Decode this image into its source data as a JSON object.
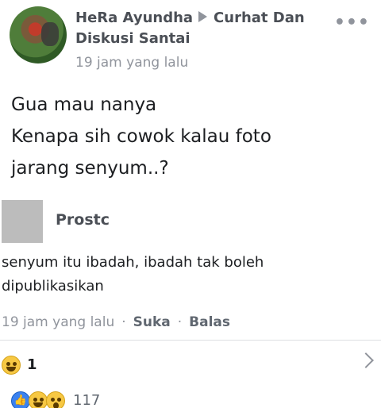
{
  "post": {
    "author": "HeRa Ayundha",
    "group_line1": "Curhat Dan",
    "group_line2": "Diskusi Santai",
    "time": "19 jam yang lalu",
    "more": "•••",
    "body_lines": [
      "Gua mau nanya",
      "Kenapa sih cowok kalau foto",
      "jarang senyum..?"
    ]
  },
  "comment": {
    "author": "Prostc",
    "text_line1": "senyum itu ibadah, ibadah tak boleh",
    "text_line2": "dipublikasikan",
    "time": "19 jam yang lalu",
    "separator": "·",
    "like_label": "Suka",
    "reply_label": "Balas",
    "reaction_icon": "haha-emoji-icon",
    "reaction_count": "1"
  },
  "post_reactions": {
    "icons": [
      "like-icon",
      "haha-emoji-icon",
      "wow-emoji-icon"
    ],
    "count": "117"
  },
  "colors": {
    "secondary_text": "#90949c",
    "like_blue": "#3b82f0",
    "emoji_yellow": "#f7c843"
  }
}
